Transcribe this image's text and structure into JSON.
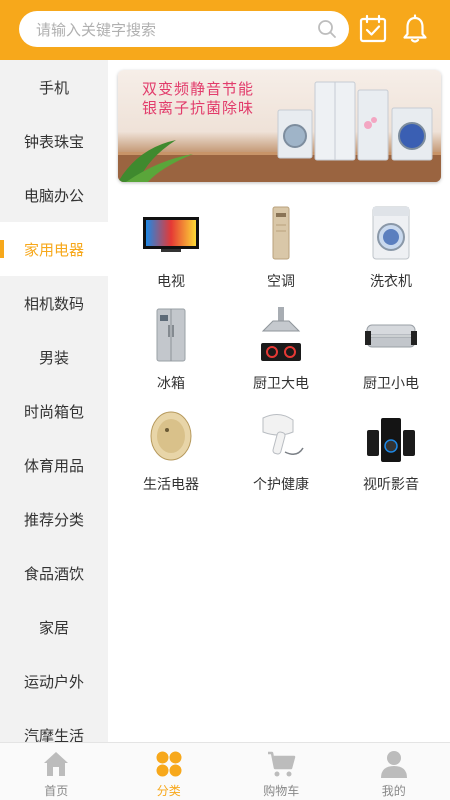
{
  "colors": {
    "accent": "#f7a81b",
    "sidebar_bg": "#f2f2f2",
    "nav_inactive": "#bcbcbc"
  },
  "header": {
    "search_placeholder": "请输入关键字搜索",
    "icons": [
      "search-icon",
      "calendar-check-icon",
      "bell-icon"
    ]
  },
  "sidebar": {
    "active_index": 3,
    "items": [
      {
        "label": "手机"
      },
      {
        "label": "钟表珠宝"
      },
      {
        "label": "电脑办公"
      },
      {
        "label": "家用电器"
      },
      {
        "label": "相机数码"
      },
      {
        "label": "男装"
      },
      {
        "label": "时尚箱包"
      },
      {
        "label": "体育用品"
      },
      {
        "label": "推荐分类"
      },
      {
        "label": "食品酒饮"
      },
      {
        "label": "家居"
      },
      {
        "label": "运动户外"
      },
      {
        "label": "汽摩生活"
      }
    ]
  },
  "banner": {
    "line1": "双变频静音节能",
    "line2": "银离子抗菌除味"
  },
  "categories": [
    {
      "label": "电视",
      "icon": "tv-icon"
    },
    {
      "label": "空调",
      "icon": "air-conditioner-icon"
    },
    {
      "label": "洗衣机",
      "icon": "washing-machine-icon"
    },
    {
      "label": "冰箱",
      "icon": "refrigerator-icon"
    },
    {
      "label": "厨卫大电",
      "icon": "range-hood-icon"
    },
    {
      "label": "厨卫小电",
      "icon": "water-purifier-icon"
    },
    {
      "label": "生活电器",
      "icon": "robot-vacuum-icon"
    },
    {
      "label": "个护健康",
      "icon": "hair-dryer-icon"
    },
    {
      "label": "视听影音",
      "icon": "speaker-icon"
    }
  ],
  "bottom_nav": {
    "active_index": 1,
    "items": [
      {
        "label": "首页",
        "icon": "home-icon"
      },
      {
        "label": "分类",
        "icon": "category-icon"
      },
      {
        "label": "购物车",
        "icon": "cart-icon"
      },
      {
        "label": "我的",
        "icon": "user-icon"
      }
    ]
  }
}
